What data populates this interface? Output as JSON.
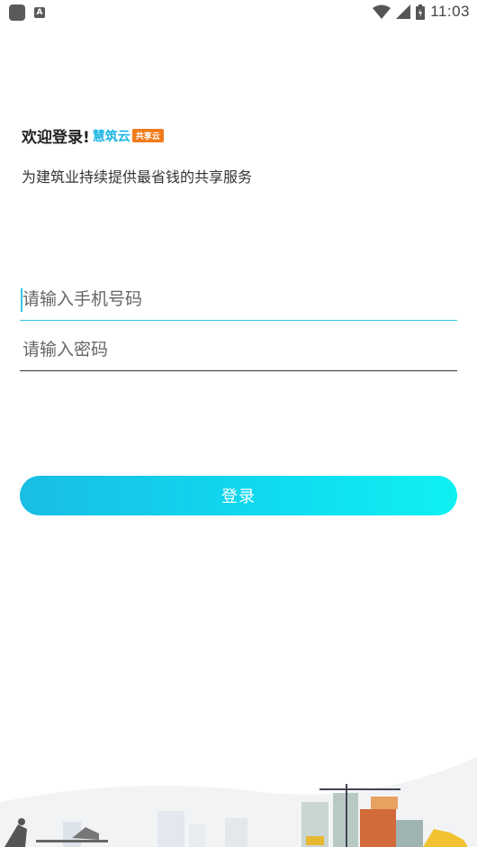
{
  "status_bar": {
    "time": "11:03",
    "notif_letter": "A"
  },
  "welcome": {
    "text": "欢迎登录!",
    "brand": "慧筑云",
    "badge": "共享云"
  },
  "subtitle": "为建筑业持续提供最省钱的共享服务",
  "form": {
    "phone_placeholder": "请输入手机号码",
    "password_placeholder": "请输入密码",
    "login_label": "登录"
  },
  "colors": {
    "accent": "#19bde4",
    "brand": "#1ab6e2",
    "badge": "#f07b1a"
  }
}
